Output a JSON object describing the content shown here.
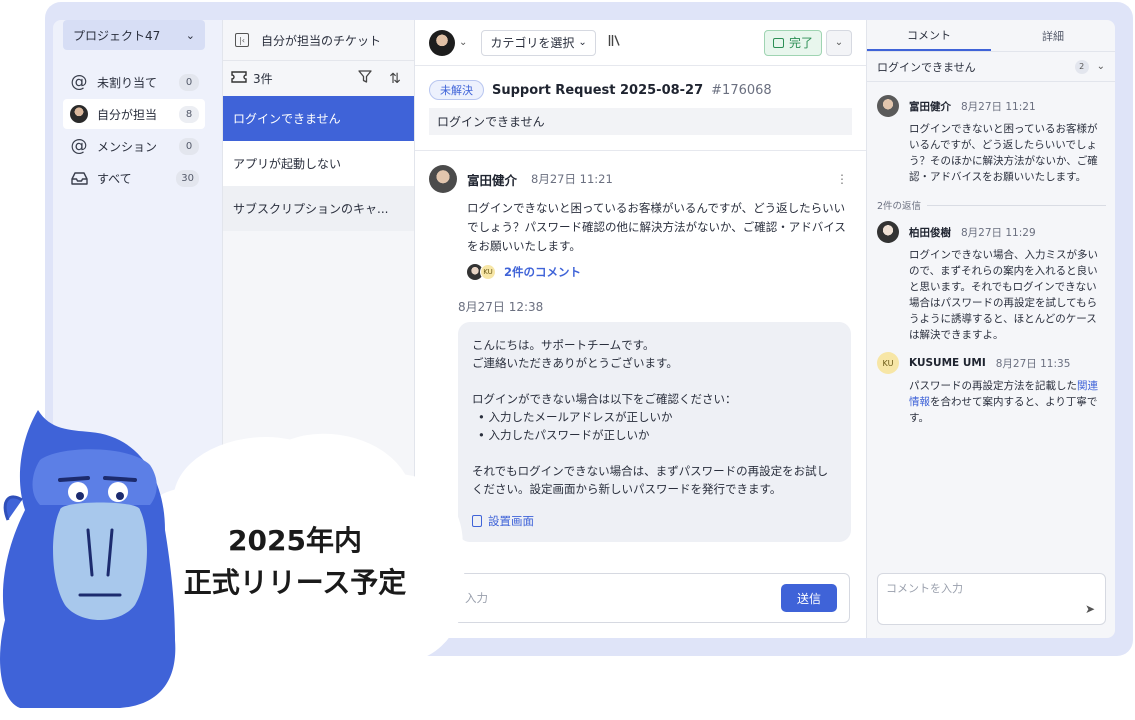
{
  "sidebar": {
    "project": "プロジェクト47",
    "items": [
      {
        "label": "未割り当て",
        "count": "0",
        "icon": "at-icon"
      },
      {
        "label": "自分が担当",
        "count": "8",
        "icon": "avatar"
      },
      {
        "label": "メンション",
        "count": "0",
        "icon": "at-icon"
      },
      {
        "label": "すべて",
        "count": "30",
        "icon": "inbox-icon"
      }
    ]
  },
  "ticket_list": {
    "title": "自分が担当のチケット",
    "count_label": "3件",
    "tickets": [
      {
        "title": "ログインできません"
      },
      {
        "title": "アプリが起動しない"
      },
      {
        "title": "サブスクリプションのキャ..."
      }
    ]
  },
  "toolbar": {
    "category_placeholder": "カテゴリを選択",
    "done_label": "完了"
  },
  "ticket": {
    "status": "未解決",
    "title": "Support Request 2025-08-27",
    "id": "#176068",
    "description": "ログインできません"
  },
  "post": {
    "author": "富田健介",
    "time": "8月27日 11:21",
    "body": "ログインできないと困っているお客様がいるんですが、どう返したらいいでしょう？パスワード確認の他に解決方法がないか、ご確認・アドバイスをお願いいたします。",
    "replies_label": "2件のコメント",
    "reply_badge": "KU"
  },
  "reply": {
    "time": "8月27日 12:38",
    "line1": "こんにちは。サポートチームです。",
    "line2": "ご連絡いただきありがとうございます。",
    "line3": "ログインができない場合は以下をご確認ください：",
    "bullet1": "入力したメールアドレスが正しいか",
    "bullet2": "入力したパスワードが正しいか",
    "line4": "それでもログインできない場合は、まずパスワードの再設定をお試しください。設定画面から新しいパスワードを発行できます。",
    "attachment": "設置画面"
  },
  "composer": {
    "placeholder": "信を入力",
    "send_label": "送信"
  },
  "right_panel": {
    "tab_comments": "コメント",
    "tab_details": "詳細",
    "selected_ticket": "ログインできません",
    "selected_count": "2",
    "parent_comment": {
      "author": "富田健介",
      "time": "8月27日 11:21",
      "body": "ログインできないと困っているお客様がいるんですが、どう返したらいいでしょう？そのほかに解決方法がないか、ご確認・アドバイスをお願いいたします。"
    },
    "replies_divider": "2件の返信",
    "reply1": {
      "author": "柏田俊樹",
      "time": "8月27日 11:29",
      "body": "ログインできない場合、入力ミスが多いので、まずそれらの案内を入れると良いと思います。それでもログインできない場合はパスワードの再設定を試してもらうように誘導すると、ほとんどのケースは解決できますよ。"
    },
    "reply2": {
      "author": "KUSUME UMI",
      "avatar_text": "KU",
      "time": "8月27日 11:35",
      "body_pre": "パスワードの再設定方法を記載した",
      "body_link": "関連情報",
      "body_post": "を合わせて案内すると、より丁寧です。"
    },
    "comment_placeholder": "コメントを入力"
  },
  "promo": {
    "line1": "2025年内",
    "line2": "正式リリース予定"
  },
  "colors": {
    "accent": "#3f63d8",
    "done_green": "#2c8f55",
    "mascot_blue": "#3f63d8"
  }
}
